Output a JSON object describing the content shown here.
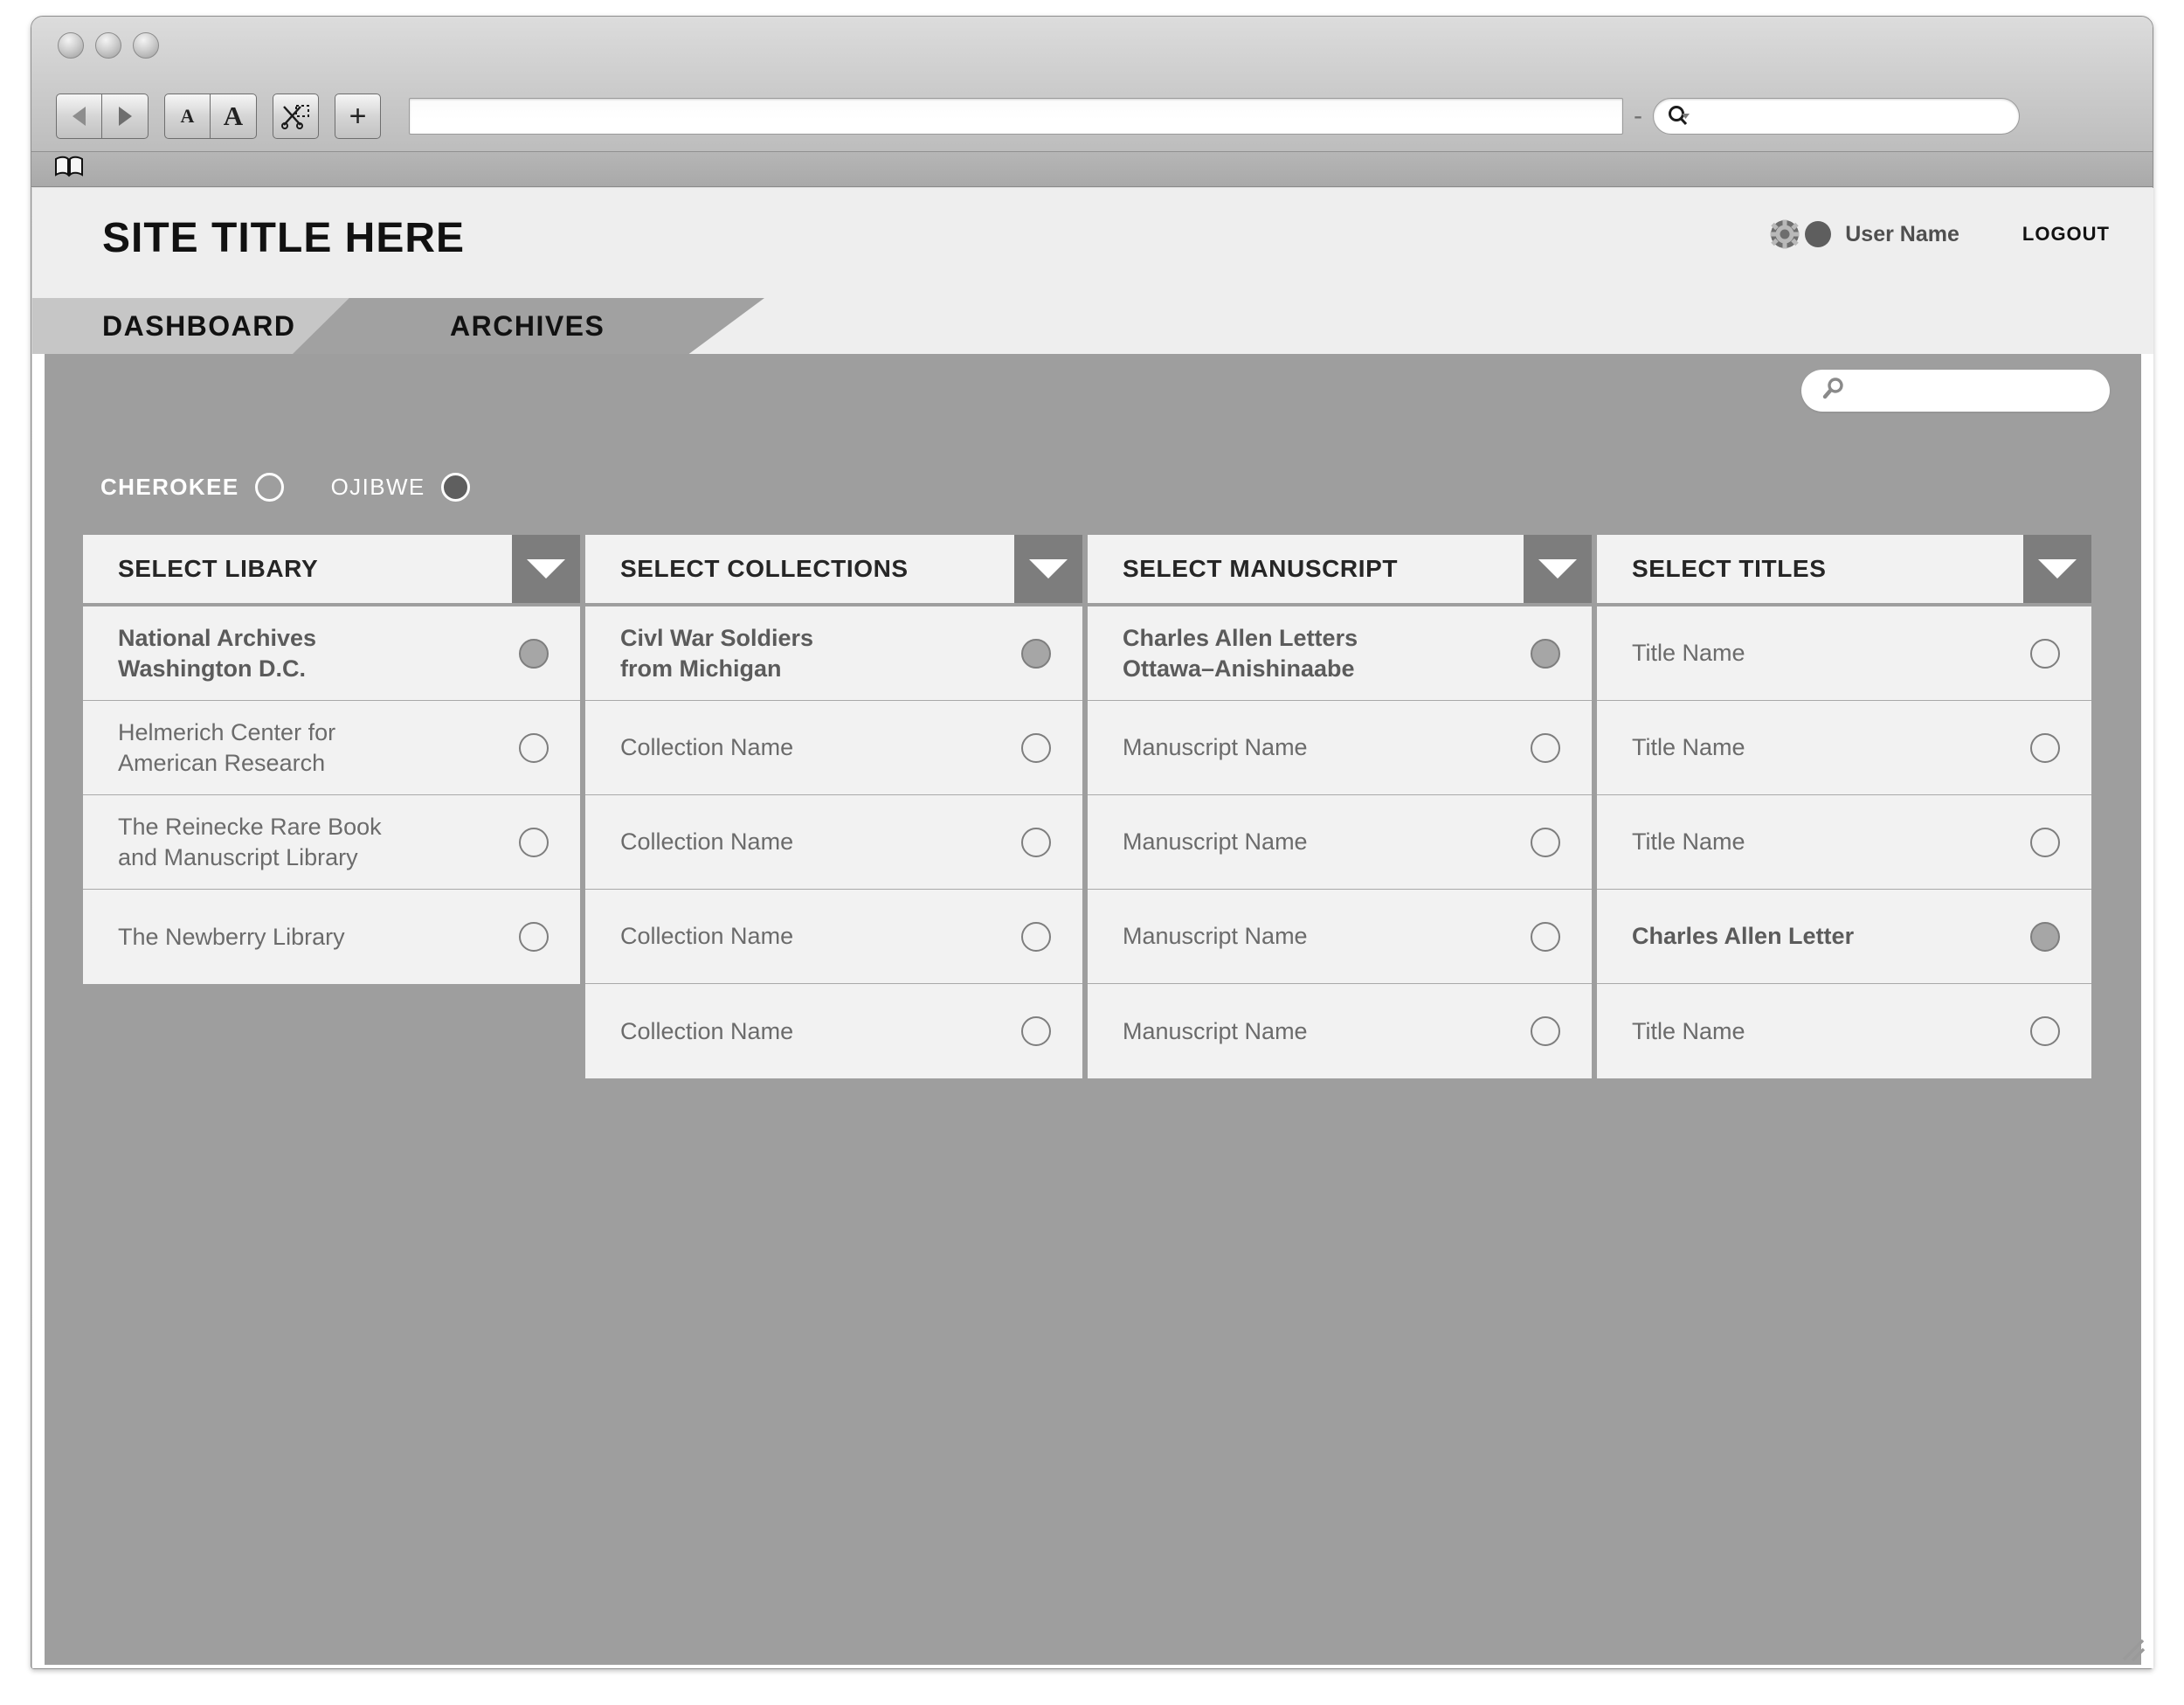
{
  "browser": {
    "back_label": "back-arrow",
    "forward_label": "forward-arrow",
    "text_smaller_label": "A",
    "text_larger_label": "A",
    "snip_label": "snip-icon",
    "add_label": "+",
    "url_value": "",
    "url_placeholder": "",
    "separator": "-",
    "chrome_search_value": "",
    "chrome_search_placeholder": "",
    "bookmark_icon": "open-book-icon"
  },
  "header": {
    "site_title": "SITE TITLE HERE",
    "gear_icon": "gear-icon",
    "avatar_icon": "avatar-circle",
    "user_name": "User Name",
    "logout_label": "LOGOUT"
  },
  "tabs": [
    {
      "label": "DASHBOARD",
      "active": false
    },
    {
      "label": "ARCHIVES",
      "active": true
    }
  ],
  "content": {
    "search": {
      "value": "",
      "placeholder": "",
      "icon": "search-icon"
    },
    "language_filters": [
      {
        "label": "CHEROKEE",
        "selected": false
      },
      {
        "label": "OJIBWE",
        "selected": true
      }
    ],
    "columns": [
      {
        "header": "SELECT LIBARY",
        "caret_icon": "chevron-down-icon",
        "rows": [
          {
            "label": "National Archives\nWashington D.C.",
            "selected": true
          },
          {
            "label": "Helmerich Center for\nAmerican Research",
            "selected": false
          },
          {
            "label": "The Reinecke Rare Book\nand Manuscript Library",
            "selected": false
          },
          {
            "label": "The Newberry Library",
            "selected": false
          }
        ]
      },
      {
        "header": "SELECT COLLECTIONS",
        "caret_icon": "chevron-down-icon",
        "rows": [
          {
            "label": "Civl War Soldiers\nfrom Michigan",
            "selected": true
          },
          {
            "label": "Collection Name",
            "selected": false
          },
          {
            "label": "Collection Name",
            "selected": false
          },
          {
            "label": "Collection Name",
            "selected": false
          },
          {
            "label": "Collection Name",
            "selected": false
          }
        ]
      },
      {
        "header": "SELECT MANUSCRIPT",
        "caret_icon": "chevron-down-icon",
        "rows": [
          {
            "label": "Charles Allen Letters\nOttawa–Anishinaabe",
            "selected": true
          },
          {
            "label": "Manuscript Name",
            "selected": false
          },
          {
            "label": "Manuscript Name",
            "selected": false
          },
          {
            "label": "Manuscript Name",
            "selected": false
          },
          {
            "label": "Manuscript Name",
            "selected": false
          }
        ]
      },
      {
        "header": "SELECT TITLES",
        "caret_icon": "chevron-down-icon",
        "rows": [
          {
            "label": "Title Name",
            "selected": false
          },
          {
            "label": "Title Name",
            "selected": false
          },
          {
            "label": "Title Name",
            "selected": false
          },
          {
            "label": "Charles Allen Letter",
            "selected": true
          },
          {
            "label": "Title Name",
            "selected": false
          }
        ]
      }
    ]
  },
  "colors": {
    "panel_gray": "#9e9e9e",
    "row_bg": "#f2f2f2",
    "caret_bg": "#7d7d7d",
    "tab_active": "#a1a1a1",
    "tab_inactive": "#c6c6c6",
    "selected_radio": "#a6a6a6"
  }
}
